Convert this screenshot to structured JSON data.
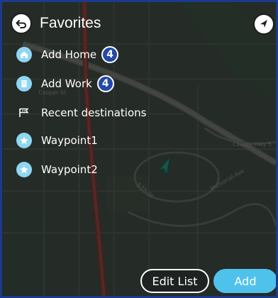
{
  "header": {
    "title": "Favorites"
  },
  "favorites": [
    {
      "label": "Add Home",
      "count": "4",
      "icon": "home-icon"
    },
    {
      "label": "Add Work",
      "count": "4",
      "icon": "work-icon"
    },
    {
      "label": "Recent destinations",
      "icon": "recent-destinations-icon"
    },
    {
      "label": "Waypoint1",
      "icon": "star-icon"
    },
    {
      "label": "Waypoint2",
      "icon": "star-icon"
    }
  ],
  "map_labels": {
    "county_hwy": "County Hwy 5",
    "cooper": "Cooper-St",
    "memorial": "Memorial-Ave",
    "fifth": "5-Th-St"
  },
  "actions": {
    "edit_label": "Edit List",
    "add_label": "Add"
  },
  "colors": {
    "accent": "#4fc2ec",
    "badge": "#2449a8",
    "icon_bg": "#8fd6f2",
    "frame": "#1a3b8c"
  }
}
